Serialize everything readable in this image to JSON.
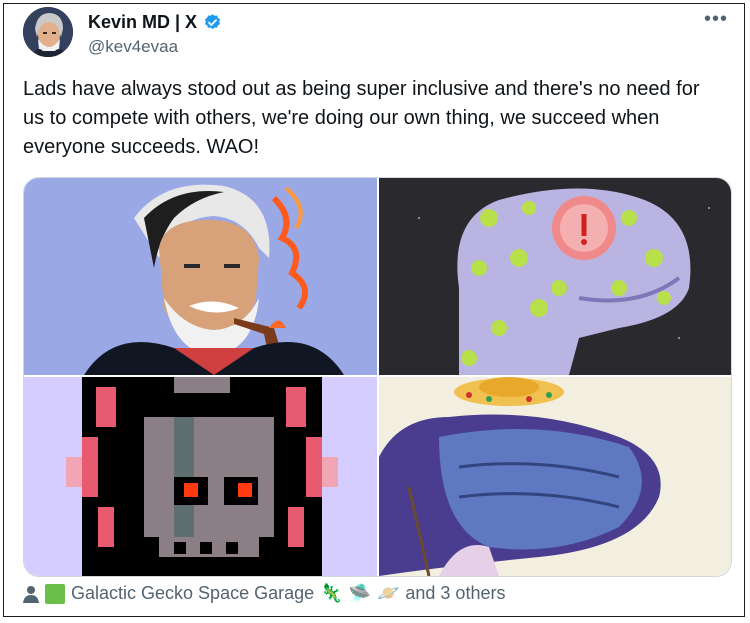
{
  "author": {
    "display_name": "Kevin MD | X",
    "handle": "@kev4evaa",
    "verified_color": "#1d9bf0"
  },
  "tweet": {
    "text": "Lads have always stood out as being super inclusive and there's no need for us to compete with others, we're doing our own thing, we succeed when everyone succeeds. WAO!"
  },
  "more_menu_icon": "ellipsis-icon",
  "footer": {
    "person_icon": "person-icon",
    "community_icon": "green-square-icon",
    "community_name": "Galactic Gecko Space Garage",
    "emojis": [
      "🦎",
      "🛸",
      "🪐"
    ],
    "others_text": "and 3 others"
  },
  "colors": {
    "text_primary": "#0f1419",
    "text_secondary": "#536471",
    "border": "#cfd9de"
  }
}
